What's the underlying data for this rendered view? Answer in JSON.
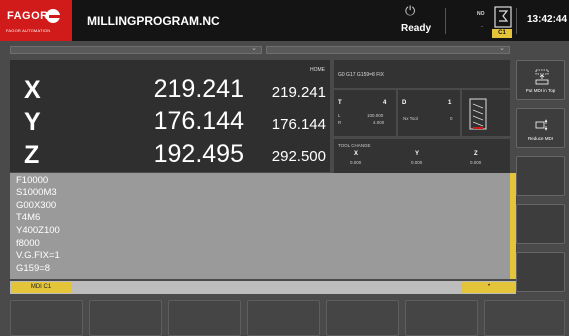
{
  "header": {
    "brand": "FAGOR",
    "brand_sub": "FAGOR AUTOMATION",
    "program_name": "MILLINGPROGRAM.NC",
    "status": "Ready",
    "no_label": "NO",
    "no_value": "-",
    "channel": "C1",
    "clock": "13:42:44"
  },
  "coords": {
    "home_label": "HOME",
    "axes": [
      {
        "name": "X",
        "command": "219.241",
        "actual": "219.241"
      },
      {
        "name": "Y",
        "command": "176.144",
        "actual": "176.144"
      },
      {
        "name": "Z",
        "command": "192.495",
        "actual": "292.500"
      }
    ]
  },
  "info": {
    "gcodes": "G0 G17 G159=8 FIX",
    "t_label": "T",
    "t_value": "4",
    "d_label": "D",
    "d_value": "1",
    "l_label": "L",
    "l_value": "100.000",
    "r_label": "R",
    "r_value": "4.000",
    "nx_tool": "Nx Tool",
    "nx_value": "0",
    "tool_change_label": "TOOL CHANGE",
    "tc_axes": [
      {
        "name": "X",
        "value": "0.000"
      },
      {
        "name": "Y",
        "value": "0.000"
      },
      {
        "name": "Z",
        "value": "0.000"
      }
    ]
  },
  "softkeys_right": [
    {
      "label": "Put MDI in Top"
    },
    {
      "label": "Reduce MDI"
    }
  ],
  "mdi": {
    "lines": [
      "F10000",
      "S1000M3",
      "G00X300",
      "T4M6",
      "Y400Z100",
      "f8000",
      "V.G.FIX=1",
      "G159=8"
    ],
    "tab_label": "MDI C1",
    "indicator": "•"
  },
  "colors": {
    "accent": "#e4c53a",
    "brand": "#d11a1a"
  }
}
